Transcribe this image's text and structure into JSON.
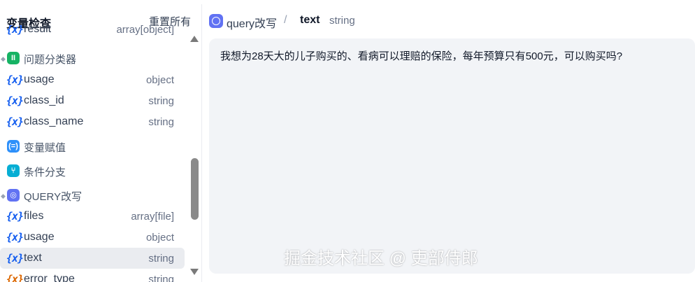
{
  "left": {
    "title": "变量检查",
    "reset_label": "重置所有",
    "rows": [
      {
        "kind": "var",
        "icon": "{x}",
        "name": "result",
        "type": "array[object]"
      },
      {
        "kind": "node",
        "name": "问题分类器",
        "badge_color": "#16b364",
        "glyph": "ll"
      },
      {
        "kind": "var",
        "icon": "{x}",
        "name": "usage",
        "type": "object"
      },
      {
        "kind": "var",
        "icon": "{x}",
        "name": "class_id",
        "type": "string"
      },
      {
        "kind": "var",
        "icon": "{x}",
        "name": "class_name",
        "type": "string"
      },
      {
        "kind": "node",
        "name": "变量赋值",
        "badge_color": "#2e90fa",
        "glyph": "="
      },
      {
        "kind": "node",
        "name": "条件分支",
        "badge_color": "#06aed4",
        "glyph": "<"
      },
      {
        "kind": "node",
        "name": "QUERY改写",
        "badge_color": "#6172f3",
        "glyph": "o"
      },
      {
        "kind": "var",
        "icon": "{x}",
        "name": "files",
        "type": "array[file]"
      },
      {
        "kind": "var",
        "icon": "{x}",
        "name": "usage",
        "type": "object"
      },
      {
        "kind": "var",
        "icon": "{x}",
        "name": "text",
        "type": "string",
        "selected": true
      },
      {
        "kind": "var",
        "icon": "{x}",
        "name": "error_type",
        "type": "string",
        "orange": true
      }
    ]
  },
  "right": {
    "node_name": "query改写",
    "separator": "/",
    "var_name": "text",
    "var_type": "string",
    "value": "我想为28天大的儿子购买的、看病可以理赔的保险，每年预算只有500元，可以购买吗?"
  },
  "watermark": "掘金技术社区 @ 吏部侍郎",
  "colors": {
    "accent": "#155eef",
    "selected_bg": "#eaecf0",
    "content_bg": "#f2f4f7"
  }
}
